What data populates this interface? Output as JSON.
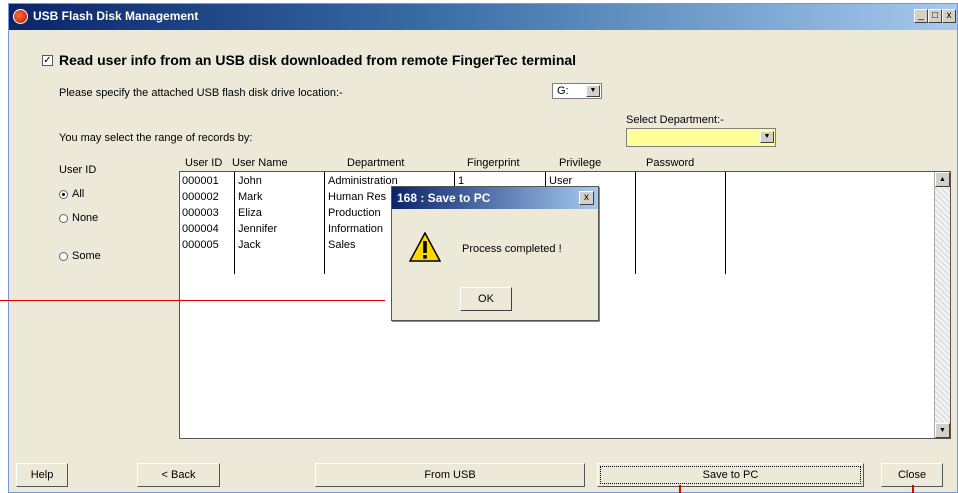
{
  "window": {
    "title": "USB Flash Disk Management",
    "controls": {
      "minimize": "_",
      "maximize": "□",
      "close": "x"
    }
  },
  "header": {
    "checkbox_checked": true,
    "heading": "Read user info from an USB disk downloaded from remote FingerTec terminal",
    "drive_label": "Please specify the attached USB flash disk drive location:-",
    "drive_value": "G:"
  },
  "filter": {
    "range_label": "You may select the range of records by:",
    "department_label": "Select Department:-",
    "department_value": "",
    "userid_label": "User ID",
    "options": [
      {
        "label": "All",
        "selected": true
      },
      {
        "label": "None",
        "selected": false
      },
      {
        "label": "Some",
        "selected": false
      }
    ]
  },
  "table": {
    "columns": [
      "User ID",
      "User Name",
      "Department",
      "Fingerprint",
      "Privilege",
      "Password"
    ],
    "rows": [
      {
        "id": "000001",
        "name": "John",
        "dept": "Administration",
        "fp": "1",
        "priv": "User"
      },
      {
        "id": "000002",
        "name": "Mark",
        "dept": "Human Res",
        "fp": "",
        "priv": ""
      },
      {
        "id": "000003",
        "name": "Eliza",
        "dept": "Production",
        "fp": "",
        "priv": ""
      },
      {
        "id": "000004",
        "name": "Jennifer",
        "dept": "Information",
        "fp": "",
        "priv": ""
      },
      {
        "id": "000005",
        "name": "Jack",
        "dept": "Sales",
        "fp": "",
        "priv": ""
      }
    ]
  },
  "buttons": {
    "help": "Help",
    "back": "< Back",
    "from_usb": "From USB",
    "save_to_pc": "Save to PC",
    "close": "Close"
  },
  "dialog": {
    "title": "168 : Save to PC",
    "message": "Process completed !",
    "ok": "OK",
    "close": "x"
  },
  "colors": {
    "window_bg": "#ece9d8",
    "department_field": "#ffff99",
    "annotation_lines": "#e00000"
  }
}
